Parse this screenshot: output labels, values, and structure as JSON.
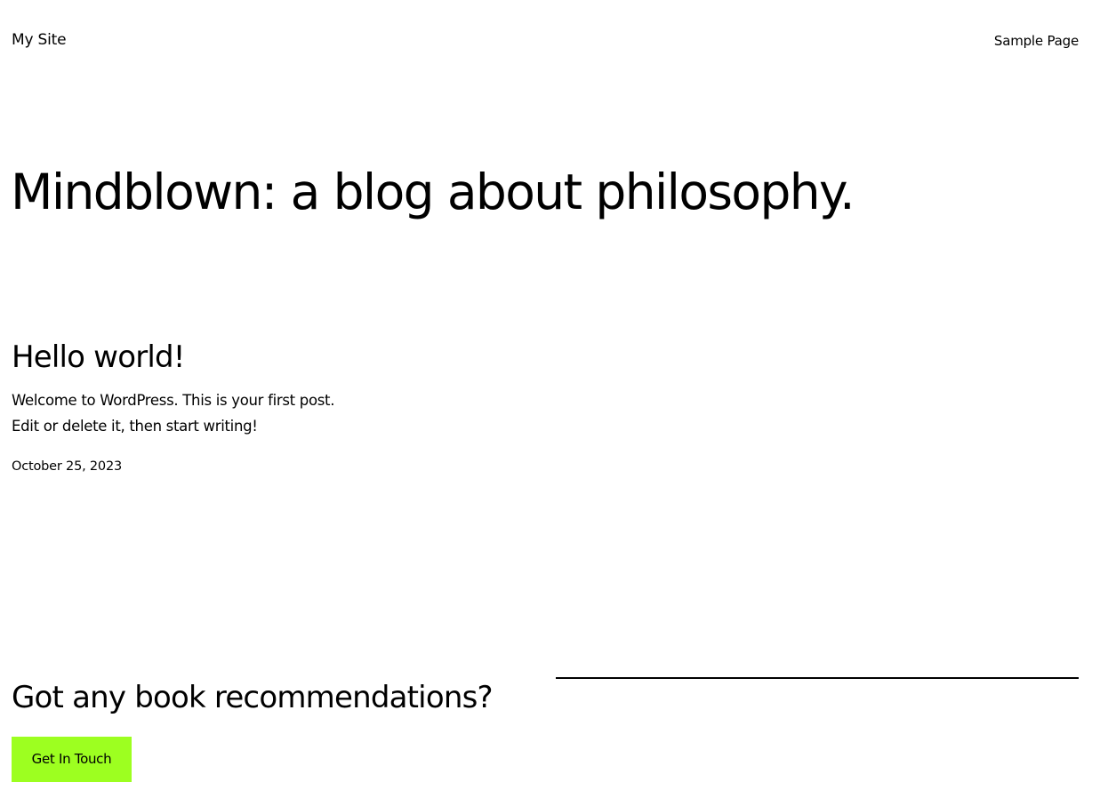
{
  "header": {
    "site_title": "My Site",
    "nav_items": [
      "Sample Page"
    ]
  },
  "hero": {
    "title": "Mindblown: a blog about philosophy."
  },
  "posts": [
    {
      "title": "Hello world!",
      "excerpt_lines": [
        "Welcome to WordPress. This is your first post.",
        "Edit or delete it, then start writing!"
      ],
      "date": "October 25, 2023"
    }
  ],
  "cta": {
    "heading": "Got any book recommendations?",
    "button_label": "Get In Touch",
    "button_color": "#9dff20"
  }
}
